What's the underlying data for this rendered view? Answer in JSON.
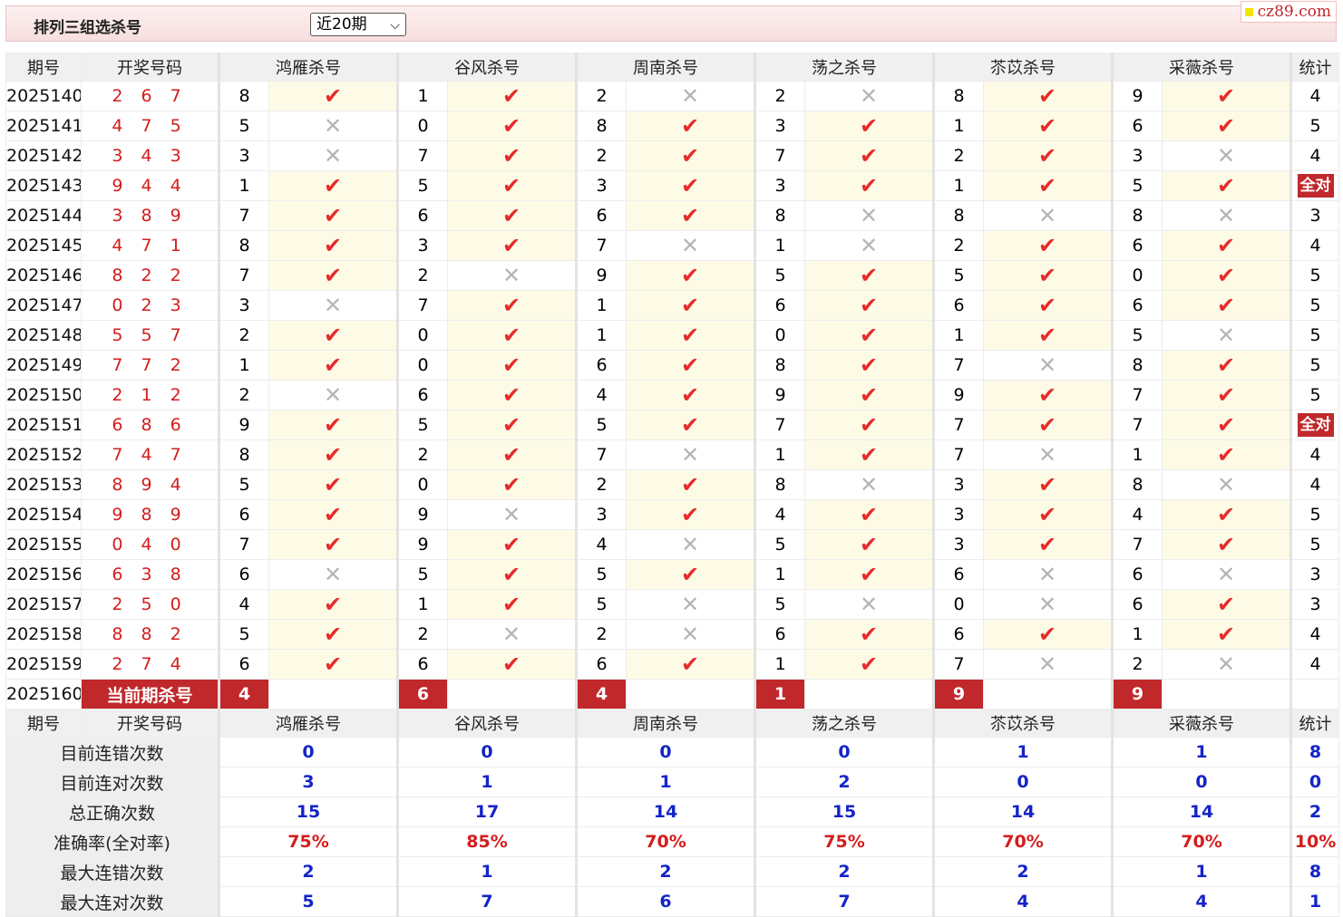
{
  "header": {
    "title": "排列三组选杀号",
    "period_select": "近20期",
    "brand": "cz89.com"
  },
  "columns": {
    "issue": "期号",
    "draw": "开奖号码",
    "count": "统计"
  },
  "experts": [
    "鸿雁杀号",
    "谷风杀号",
    "周南杀号",
    "荡之杀号",
    "苶苡杀号",
    "采薇杀号"
  ],
  "all_correct_label": "全对",
  "rows": [
    {
      "issue": "2025140",
      "draw": "2 6 7",
      "kills": [
        8,
        1,
        2,
        2,
        8,
        9
      ],
      "ok": [
        1,
        1,
        0,
        0,
        1,
        1
      ],
      "count": "4"
    },
    {
      "issue": "2025141",
      "draw": "4 7 5",
      "kills": [
        5,
        0,
        8,
        3,
        1,
        6
      ],
      "ok": [
        0,
        1,
        1,
        1,
        1,
        1
      ],
      "count": "5"
    },
    {
      "issue": "2025142",
      "draw": "3 4 3",
      "kills": [
        3,
        7,
        2,
        7,
        2,
        3
      ],
      "ok": [
        0,
        1,
        1,
        1,
        1,
        0
      ],
      "count": "4"
    },
    {
      "issue": "2025143",
      "draw": "9 4 4",
      "kills": [
        1,
        5,
        3,
        3,
        1,
        5
      ],
      "ok": [
        1,
        1,
        1,
        1,
        1,
        1
      ],
      "count": "全对"
    },
    {
      "issue": "2025144",
      "draw": "3 8 9",
      "kills": [
        7,
        6,
        6,
        8,
        8,
        8
      ],
      "ok": [
        1,
        1,
        1,
        0,
        0,
        0
      ],
      "count": "3"
    },
    {
      "issue": "2025145",
      "draw": "4 7 1",
      "kills": [
        8,
        3,
        7,
        1,
        2,
        6
      ],
      "ok": [
        1,
        1,
        0,
        0,
        1,
        1
      ],
      "count": "4"
    },
    {
      "issue": "2025146",
      "draw": "8 2 2",
      "kills": [
        7,
        2,
        9,
        5,
        5,
        0
      ],
      "ok": [
        1,
        0,
        1,
        1,
        1,
        1
      ],
      "count": "5"
    },
    {
      "issue": "2025147",
      "draw": "0 2 3",
      "kills": [
        3,
        7,
        1,
        6,
        6,
        6
      ],
      "ok": [
        0,
        1,
        1,
        1,
        1,
        1
      ],
      "count": "5"
    },
    {
      "issue": "2025148",
      "draw": "5 5 7",
      "kills": [
        2,
        0,
        1,
        0,
        1,
        5
      ],
      "ok": [
        1,
        1,
        1,
        1,
        1,
        0
      ],
      "count": "5"
    },
    {
      "issue": "2025149",
      "draw": "7 7 2",
      "kills": [
        1,
        0,
        6,
        8,
        7,
        8
      ],
      "ok": [
        1,
        1,
        1,
        1,
        0,
        1
      ],
      "count": "5"
    },
    {
      "issue": "2025150",
      "draw": "2 1 2",
      "kills": [
        2,
        6,
        4,
        9,
        9,
        7
      ],
      "ok": [
        0,
        1,
        1,
        1,
        1,
        1
      ],
      "count": "5"
    },
    {
      "issue": "2025151",
      "draw": "6 8 6",
      "kills": [
        9,
        5,
        5,
        7,
        7,
        7
      ],
      "ok": [
        1,
        1,
        1,
        1,
        1,
        1
      ],
      "count": "全对"
    },
    {
      "issue": "2025152",
      "draw": "7 4 7",
      "kills": [
        8,
        2,
        7,
        1,
        7,
        1
      ],
      "ok": [
        1,
        1,
        0,
        1,
        0,
        1
      ],
      "count": "4"
    },
    {
      "issue": "2025153",
      "draw": "8 9 4",
      "kills": [
        5,
        0,
        2,
        8,
        3,
        8
      ],
      "ok": [
        1,
        1,
        1,
        0,
        1,
        0
      ],
      "count": "4"
    },
    {
      "issue": "2025154",
      "draw": "9 8 9",
      "kills": [
        6,
        9,
        3,
        4,
        3,
        4
      ],
      "ok": [
        1,
        0,
        1,
        1,
        1,
        1
      ],
      "count": "5"
    },
    {
      "issue": "2025155",
      "draw": "0 4 0",
      "kills": [
        7,
        9,
        4,
        5,
        3,
        7
      ],
      "ok": [
        1,
        1,
        0,
        1,
        1,
        1
      ],
      "count": "5"
    },
    {
      "issue": "2025156",
      "draw": "6 3 8",
      "kills": [
        6,
        5,
        5,
        1,
        6,
        6
      ],
      "ok": [
        0,
        1,
        1,
        1,
        0,
        0
      ],
      "count": "3"
    },
    {
      "issue": "2025157",
      "draw": "2 5 0",
      "kills": [
        4,
        1,
        5,
        5,
        0,
        6
      ],
      "ok": [
        1,
        1,
        0,
        0,
        0,
        1
      ],
      "count": "3"
    },
    {
      "issue": "2025158",
      "draw": "8 8 2",
      "kills": [
        5,
        2,
        2,
        6,
        6,
        1
      ],
      "ok": [
        1,
        0,
        0,
        1,
        1,
        1
      ],
      "count": "4"
    },
    {
      "issue": "2025159",
      "draw": "2 7 4",
      "kills": [
        6,
        6,
        6,
        1,
        7,
        2
      ],
      "ok": [
        1,
        1,
        1,
        1,
        0,
        0
      ],
      "count": "4"
    }
  ],
  "current": {
    "issue": "2025160",
    "label": "当前期杀号",
    "kills": [
      "4",
      "6",
      "4",
      "1",
      "9",
      "9"
    ]
  },
  "stats": [
    {
      "label": "目前连错次数",
      "values": [
        "0",
        "0",
        "0",
        "0",
        "1",
        "1"
      ],
      "total": "8"
    },
    {
      "label": "目前连对次数",
      "values": [
        "3",
        "1",
        "1",
        "2",
        "0",
        "0"
      ],
      "total": "0"
    },
    {
      "label": "总正确次数",
      "values": [
        "15",
        "17",
        "14",
        "15",
        "14",
        "14"
      ],
      "total": "2"
    },
    {
      "label": "准确率(全对率)",
      "values": [
        "75%",
        "85%",
        "70%",
        "75%",
        "70%",
        "70%"
      ],
      "total": "10%"
    },
    {
      "label": "最大连错次数",
      "values": [
        "2",
        "1",
        "2",
        "2",
        "2",
        "1"
      ],
      "total": "8"
    },
    {
      "label": "最大连对次数",
      "values": [
        "5",
        "7",
        "6",
        "7",
        "4",
        "4"
      ],
      "total": "1"
    }
  ],
  "icons": {
    "correct": "check-icon",
    "wrong": "cross-icon"
  },
  "colors": {
    "accent_red": "#c0282b",
    "draw_red": "#d41c1c",
    "stat_blue": "#1424c8",
    "correct_bg": "#fdfbe6"
  }
}
